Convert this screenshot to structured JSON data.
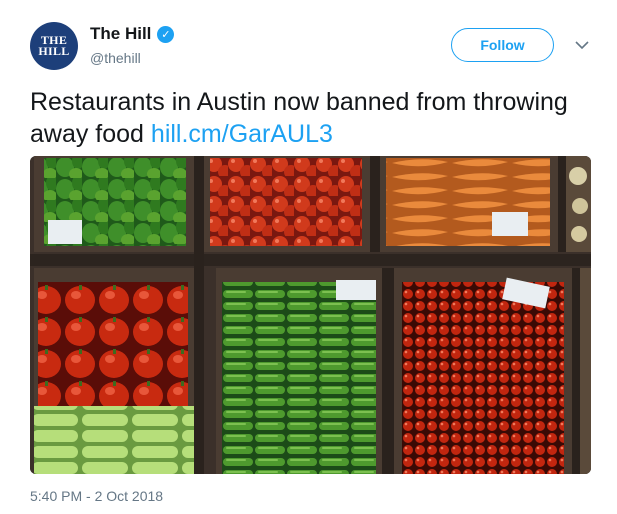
{
  "author": {
    "avatar_line1": "THE",
    "avatar_line2": "HILL",
    "name": "The Hill",
    "verified_icon": "verified-badge-icon",
    "handle": "@thehill"
  },
  "actions": {
    "follow_label": "Follow",
    "more_icon": "chevron-down-icon"
  },
  "tweet": {
    "text": "Restaurants in Austin now banned from throwing away food",
    "link": "hill.cm/GarAUL3"
  },
  "media": {
    "icon": "photo-vegetable-crates"
  },
  "timestamp": "5:40 PM - 2 Oct 2018",
  "colors": {
    "accent": "#1da1f2",
    "avatar_bg": "#1d3f7a",
    "muted": "#657786"
  }
}
